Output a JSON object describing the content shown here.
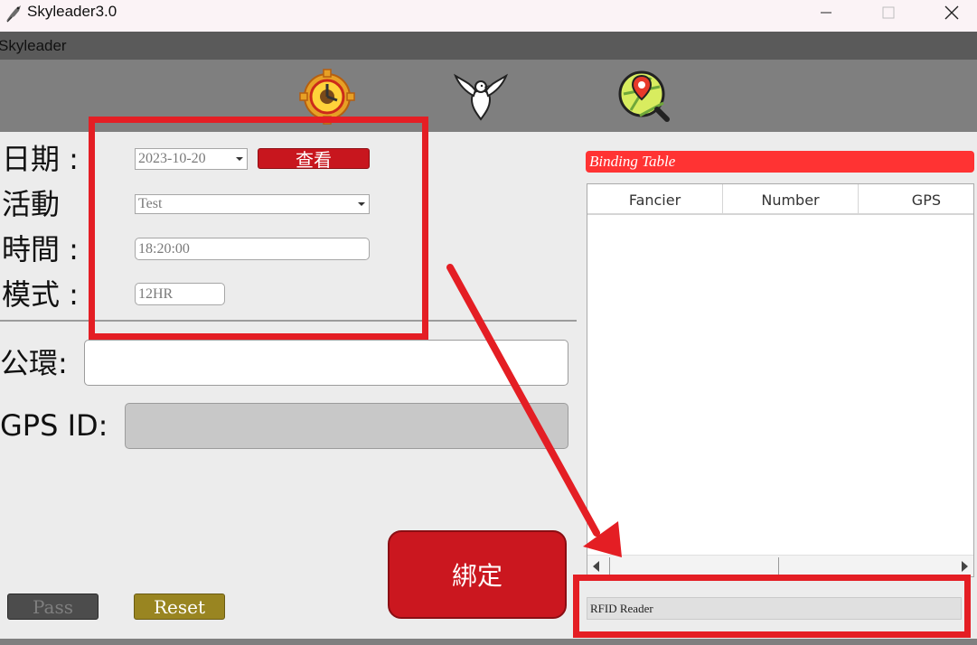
{
  "window": {
    "title": "Skyleader3.0",
    "app_icon": "pigeon-feather-icon",
    "controls": [
      "minimize-icon",
      "maximize-icon",
      "close-icon"
    ]
  },
  "menubar": {
    "title": "Skyleader"
  },
  "toolbar": {
    "items": [
      {
        "name": "settings-gear-clock",
        "icon": "gear-clock-icon"
      },
      {
        "name": "pigeon",
        "icon": "pigeon-icon"
      },
      {
        "name": "map-search",
        "icon": "map-search-icon"
      }
    ]
  },
  "form": {
    "date_label": "日期 :",
    "date_value": "2023-10-20",
    "view_button": "查看",
    "activity_label": "活動",
    "activity_value": "Test",
    "time_label": "時間 :",
    "time_value": "18:20:00",
    "mode_label": "模式 :",
    "mode_value": "12HR",
    "ring_label": "公環:",
    "ring_value": "",
    "gps_label": "GPS ID:",
    "gps_value": ""
  },
  "buttons": {
    "bind": "綁定",
    "pass": "Pass",
    "reset": "Reset"
  },
  "binding_table": {
    "title": "Binding Table",
    "columns": [
      "Fancier",
      "Number",
      "GPS"
    ],
    "rows": []
  },
  "status": {
    "rfid": "RFID Reader"
  },
  "colors": {
    "accent_red": "#c8161e",
    "annotation_red": "#e41e24",
    "table_title_red": "#ff3333",
    "reset_gold": "#998521",
    "toolbar_gray": "#7f7f7f"
  }
}
